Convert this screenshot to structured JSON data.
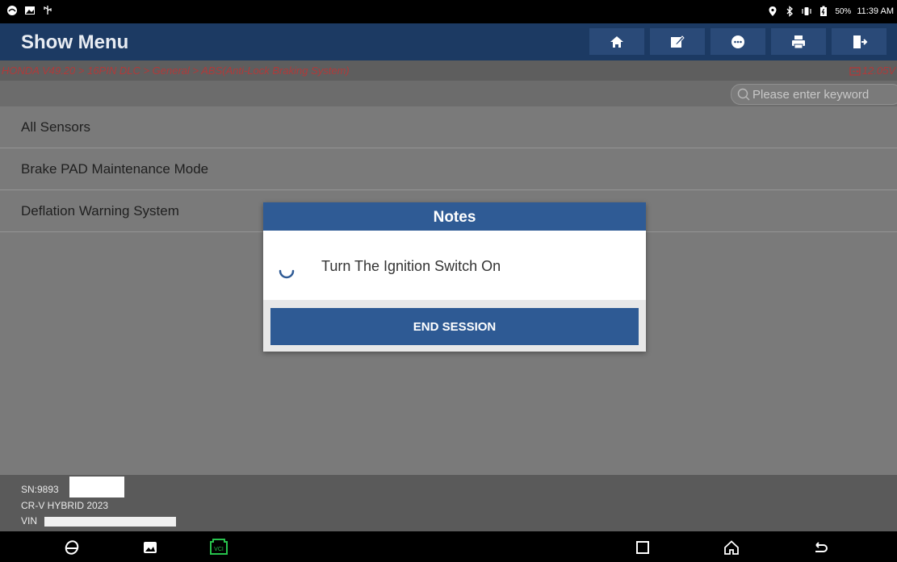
{
  "status_bar": {
    "battery": "50%",
    "time": "11:39 AM"
  },
  "header": {
    "title": "Show Menu",
    "buttons": [
      "home-icon",
      "edit-icon",
      "chat-icon",
      "print-icon",
      "exit-icon"
    ]
  },
  "breadcrumb": {
    "path": "HONDA V49.20 > 16PIN DLC > General > ABS(Anti-Lock Braking System)",
    "voltage": "12.05V"
  },
  "search": {
    "placeholder": "Please enter keyword"
  },
  "menu": {
    "items": [
      {
        "label": "All Sensors"
      },
      {
        "label": "Brake PAD Maintenance Mode"
      },
      {
        "label": "Deflation Warning System"
      }
    ]
  },
  "footer": {
    "sn": "SN:9893",
    "vehicle": "CR-V HYBRID 2023",
    "vin": "VIN"
  },
  "dialog": {
    "title": "Notes",
    "message": "Turn The Ignition Switch On",
    "button": "END SESSION"
  },
  "colors": {
    "header_bg": "#1c3a63",
    "dialog_header": "#2f5b95",
    "button": "#2e5a94",
    "breadcrumb_text": "#b03a3a",
    "vci_icon": "#27c24c"
  }
}
